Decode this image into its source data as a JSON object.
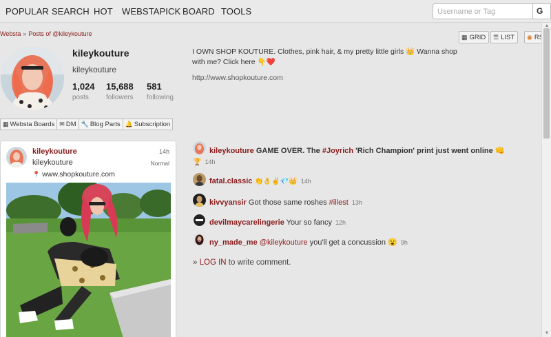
{
  "nav": {
    "items": [
      "POPULAR",
      "SEARCH",
      "HOT",
      "WEBSTAPICK",
      "BOARD",
      "TOOLS"
    ],
    "search_placeholder": "Username or Tag",
    "search_button": "G"
  },
  "breadcrumb": {
    "root": "Websta",
    "separator": "»",
    "current": "Posts of @kileykouture"
  },
  "view": {
    "grid": "GRID",
    "list": "LIST",
    "rss": "RS"
  },
  "profile": {
    "display_name": "kileykouture",
    "username": "kileykouture",
    "posts_count": "1,024",
    "posts_label": "posts",
    "followers_count": "15,688",
    "followers_label": "followers",
    "following_count": "581",
    "following_label": "following",
    "bio_line1": "I OWN SHOP KOUTURE. Clothes, pink hair, & my pretty little girls 👑 Wanna shop",
    "bio_line2": "with me? Click here 👇❤️",
    "url": "http://www.shopkouture.com"
  },
  "tools": {
    "boards": "Websta Boards",
    "dm": "DM",
    "blog": "Blog Parts",
    "subscription": "Subscription"
  },
  "post": {
    "author": "kileykouture",
    "time": "14h",
    "username": "kileykouture",
    "filter": "Normal",
    "location": "www.shopkouture.com"
  },
  "comments": [
    {
      "user": "kileykouture",
      "text_a": "GAME OVER. The ",
      "tag": "#Joyrich",
      "text_b": " 'Rich Champion' print just went online 👊",
      "line2": "🏆",
      "time": "14h"
    },
    {
      "user": "fatal.classic",
      "emoji": "👏👌✌💎👑",
      "time": "14h"
    },
    {
      "user": "kivvyansir",
      "text": "Got those same roshes ",
      "tag": "#illest",
      "time": "13h"
    },
    {
      "user": "devilmaycarelingerie",
      "text": "Your so fancy",
      "time": "12h"
    },
    {
      "user": "ny_made_me",
      "mention": "@kileykouture",
      "text": " you'll get a concussion 😮",
      "time": "9h"
    }
  ],
  "login": {
    "prefix": "»",
    "link": "LOG IN",
    "suffix": " to write comment."
  },
  "colors": {
    "accent": "#8a1c1c",
    "background": "#e7e7e7"
  }
}
